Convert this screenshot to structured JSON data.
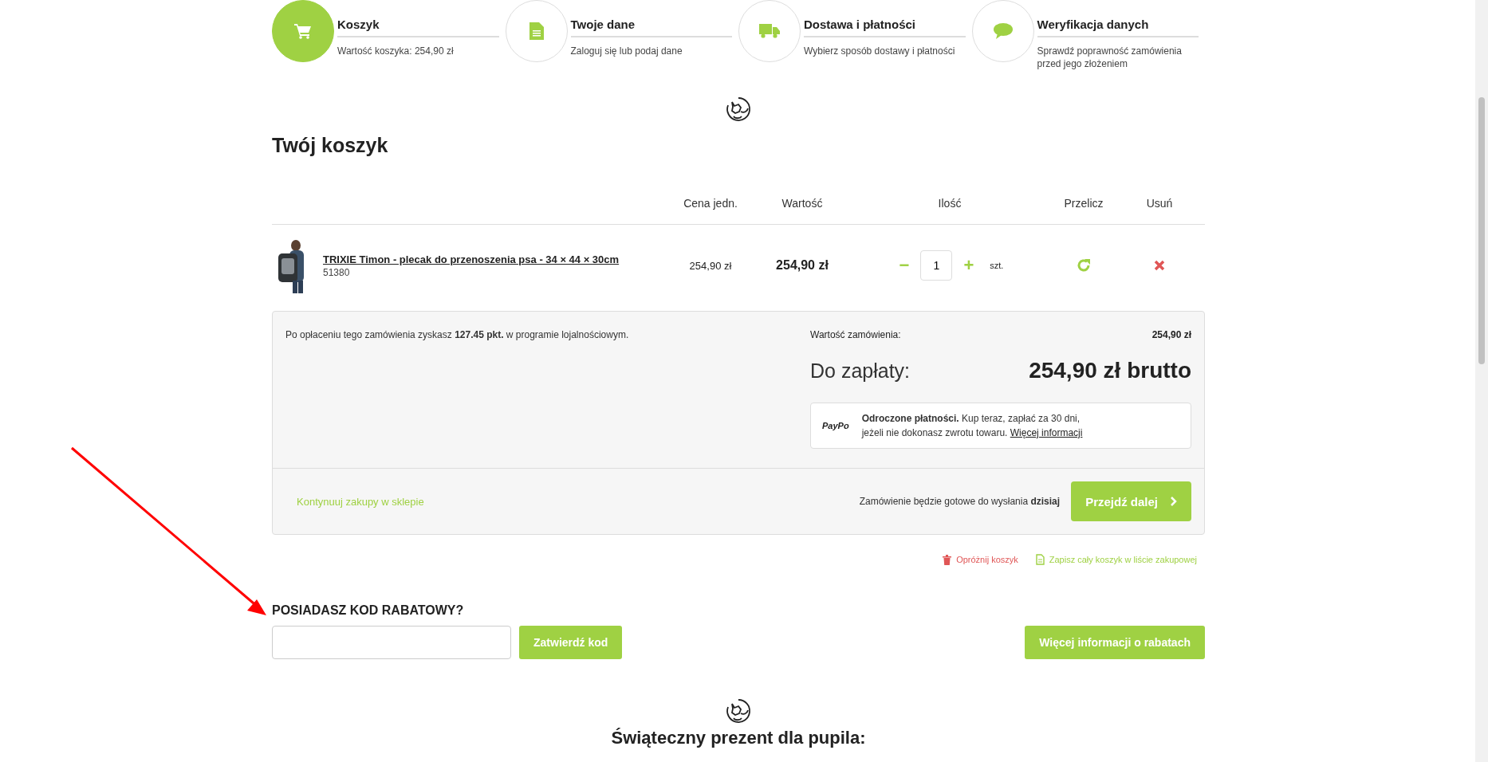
{
  "steps": [
    {
      "kind": "cart",
      "title": "Koszyk",
      "subtitle": "Wartość koszyka: 254,90 zł",
      "selected": true
    },
    {
      "kind": "document",
      "title": "Twoje dane",
      "subtitle": "Zaloguj się lub podaj dane",
      "selected": false
    },
    {
      "kind": "truck",
      "title": "Dostawa i płatności",
      "subtitle": "Wybierz sposób dostawy i płatności",
      "selected": false
    },
    {
      "kind": "chat",
      "title": "Weryfikacja danych",
      "subtitle": "Sprawdź poprawność zamówienia przed jego złożeniem",
      "selected": false
    }
  ],
  "cart": {
    "title": "Twój koszyk",
    "columns": [
      "Cena jedn.",
      "Wartość",
      "Ilość",
      "Przelicz",
      "Usuń"
    ],
    "items": [
      {
        "name": "TRIXIE Timon - plecak do przenoszenia psa - 34 × 44 × 30cm",
        "sku": "51380",
        "unit_price": "254,90 zł",
        "value": "254,90 zł",
        "quantity": "1",
        "minus": "−",
        "plus": "+",
        "unit": "szt."
      }
    ]
  },
  "summary": {
    "loyalty_note": "Po opłaceniu tego zamówienia zyskasz **127.45 pkt.** w programie lojalnościowym.",
    "order_value_label": "Wartość zamówienia:",
    "order_value": "254,90 zł",
    "to_pay_label": "Do zapłaty:",
    "to_pay": "254,90 zł brutto",
    "paypo": {
      "logo": "PayPo",
      "line_1": "**Odroczone płatności.** Kup teraz, zapłać za 30 dni,",
      "line_2": "jeżeli nie dokonasz zwrotu towaru.",
      "link": "Więcej informacji"
    },
    "continue_link": "Kontynuuj zakupy w sklepie",
    "ready_note": "Zamówienie będzie gotowe do wysłania **dzisiaj**",
    "next_button": "Przejdź dalej"
  },
  "actions": [
    {
      "kind": "clear",
      "label": "Opróżnij koszyk"
    },
    {
      "kind": "save",
      "label": "Zapisz cały koszyk w liście zakupowej"
    }
  ],
  "discount": {
    "title": "POSIADASZ KOD RABATOWY?",
    "submit": "Zatwierdź kod",
    "more_button": "Więcej informacji o rabatach"
  },
  "section_heading": "Świąteczny prezent dla pupila:"
}
